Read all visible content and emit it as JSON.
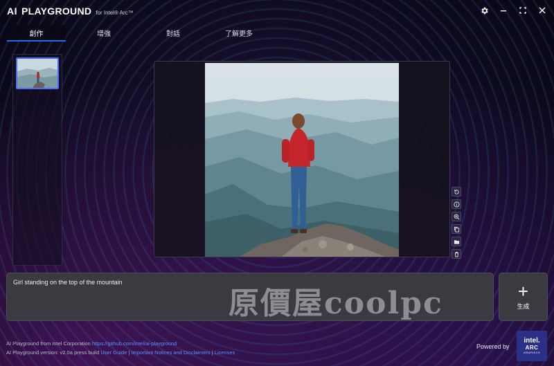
{
  "app": {
    "brand_ai": "AI",
    "brand_name": "PLAYGROUND",
    "brand_sub": "for Intel® Arc™"
  },
  "window_controls": {
    "settings_icon": "gear-icon",
    "minimize_icon": "minimize-icon",
    "maximize_icon": "maximize-icon",
    "close_icon": "close-icon"
  },
  "tabs": [
    {
      "label": "創作"
    },
    {
      "label": "增強"
    },
    {
      "label": "對話"
    },
    {
      "label": "了解更多"
    }
  ],
  "gallery": {
    "thumbnails": [
      {
        "selected": true
      }
    ]
  },
  "tools": [
    {
      "icon": "regenerate-icon"
    },
    {
      "icon": "info-icon"
    },
    {
      "icon": "zoom-in-icon"
    },
    {
      "icon": "copy-icon"
    },
    {
      "icon": "folder-icon"
    },
    {
      "icon": "trash-icon"
    }
  ],
  "prompt": {
    "value": "Girl standing on the top of the mountain"
  },
  "watermark": {
    "text": "原價屋coolpc"
  },
  "generate": {
    "label": "生成"
  },
  "footer": {
    "line1_prefix": "AI Playground from Intel Corporation",
    "line1_link": "https://github.com/intel/ai-playground",
    "line2_prefix": "AI Playground version: v2.0a press build",
    "user_guide": "User Guide",
    "sep": "|",
    "notices": "Important Notices and Disclaimers",
    "licenses": "Licenses",
    "powered_by": "Powered by"
  },
  "intel_badge": {
    "l1": "intel.",
    "l2": "ARC",
    "l3": "GRAPHICS"
  },
  "colors": {
    "accent": "#1e6ee8",
    "link": "#5a92ff",
    "intel_blue": "#2b2f86"
  }
}
